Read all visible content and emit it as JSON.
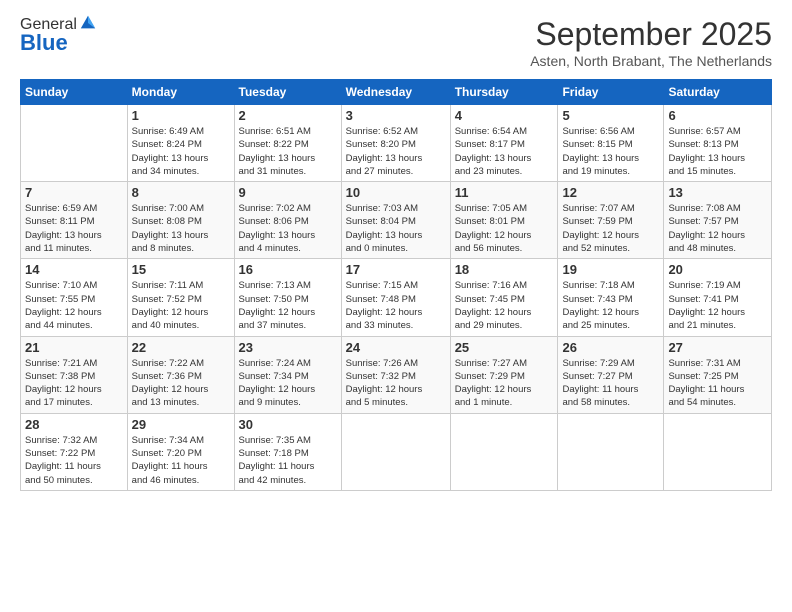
{
  "header": {
    "logo_line1": "General",
    "logo_line2": "Blue",
    "month_title": "September 2025",
    "subtitle": "Asten, North Brabant, The Netherlands"
  },
  "weekdays": [
    "Sunday",
    "Monday",
    "Tuesday",
    "Wednesday",
    "Thursday",
    "Friday",
    "Saturday"
  ],
  "weeks": [
    [
      {
        "day": "",
        "info": ""
      },
      {
        "day": "1",
        "info": "Sunrise: 6:49 AM\nSunset: 8:24 PM\nDaylight: 13 hours\nand 34 minutes."
      },
      {
        "day": "2",
        "info": "Sunrise: 6:51 AM\nSunset: 8:22 PM\nDaylight: 13 hours\nand 31 minutes."
      },
      {
        "day": "3",
        "info": "Sunrise: 6:52 AM\nSunset: 8:20 PM\nDaylight: 13 hours\nand 27 minutes."
      },
      {
        "day": "4",
        "info": "Sunrise: 6:54 AM\nSunset: 8:17 PM\nDaylight: 13 hours\nand 23 minutes."
      },
      {
        "day": "5",
        "info": "Sunrise: 6:56 AM\nSunset: 8:15 PM\nDaylight: 13 hours\nand 19 minutes."
      },
      {
        "day": "6",
        "info": "Sunrise: 6:57 AM\nSunset: 8:13 PM\nDaylight: 13 hours\nand 15 minutes."
      }
    ],
    [
      {
        "day": "7",
        "info": "Sunrise: 6:59 AM\nSunset: 8:11 PM\nDaylight: 13 hours\nand 11 minutes."
      },
      {
        "day": "8",
        "info": "Sunrise: 7:00 AM\nSunset: 8:08 PM\nDaylight: 13 hours\nand 8 minutes."
      },
      {
        "day": "9",
        "info": "Sunrise: 7:02 AM\nSunset: 8:06 PM\nDaylight: 13 hours\nand 4 minutes."
      },
      {
        "day": "10",
        "info": "Sunrise: 7:03 AM\nSunset: 8:04 PM\nDaylight: 13 hours\nand 0 minutes."
      },
      {
        "day": "11",
        "info": "Sunrise: 7:05 AM\nSunset: 8:01 PM\nDaylight: 12 hours\nand 56 minutes."
      },
      {
        "day": "12",
        "info": "Sunrise: 7:07 AM\nSunset: 7:59 PM\nDaylight: 12 hours\nand 52 minutes."
      },
      {
        "day": "13",
        "info": "Sunrise: 7:08 AM\nSunset: 7:57 PM\nDaylight: 12 hours\nand 48 minutes."
      }
    ],
    [
      {
        "day": "14",
        "info": "Sunrise: 7:10 AM\nSunset: 7:55 PM\nDaylight: 12 hours\nand 44 minutes."
      },
      {
        "day": "15",
        "info": "Sunrise: 7:11 AM\nSunset: 7:52 PM\nDaylight: 12 hours\nand 40 minutes."
      },
      {
        "day": "16",
        "info": "Sunrise: 7:13 AM\nSunset: 7:50 PM\nDaylight: 12 hours\nand 37 minutes."
      },
      {
        "day": "17",
        "info": "Sunrise: 7:15 AM\nSunset: 7:48 PM\nDaylight: 12 hours\nand 33 minutes."
      },
      {
        "day": "18",
        "info": "Sunrise: 7:16 AM\nSunset: 7:45 PM\nDaylight: 12 hours\nand 29 minutes."
      },
      {
        "day": "19",
        "info": "Sunrise: 7:18 AM\nSunset: 7:43 PM\nDaylight: 12 hours\nand 25 minutes."
      },
      {
        "day": "20",
        "info": "Sunrise: 7:19 AM\nSunset: 7:41 PM\nDaylight: 12 hours\nand 21 minutes."
      }
    ],
    [
      {
        "day": "21",
        "info": "Sunrise: 7:21 AM\nSunset: 7:38 PM\nDaylight: 12 hours\nand 17 minutes."
      },
      {
        "day": "22",
        "info": "Sunrise: 7:22 AM\nSunset: 7:36 PM\nDaylight: 12 hours\nand 13 minutes."
      },
      {
        "day": "23",
        "info": "Sunrise: 7:24 AM\nSunset: 7:34 PM\nDaylight: 12 hours\nand 9 minutes."
      },
      {
        "day": "24",
        "info": "Sunrise: 7:26 AM\nSunset: 7:32 PM\nDaylight: 12 hours\nand 5 minutes."
      },
      {
        "day": "25",
        "info": "Sunrise: 7:27 AM\nSunset: 7:29 PM\nDaylight: 12 hours\nand 1 minute."
      },
      {
        "day": "26",
        "info": "Sunrise: 7:29 AM\nSunset: 7:27 PM\nDaylight: 11 hours\nand 58 minutes."
      },
      {
        "day": "27",
        "info": "Sunrise: 7:31 AM\nSunset: 7:25 PM\nDaylight: 11 hours\nand 54 minutes."
      }
    ],
    [
      {
        "day": "28",
        "info": "Sunrise: 7:32 AM\nSunset: 7:22 PM\nDaylight: 11 hours\nand 50 minutes."
      },
      {
        "day": "29",
        "info": "Sunrise: 7:34 AM\nSunset: 7:20 PM\nDaylight: 11 hours\nand 46 minutes."
      },
      {
        "day": "30",
        "info": "Sunrise: 7:35 AM\nSunset: 7:18 PM\nDaylight: 11 hours\nand 42 minutes."
      },
      {
        "day": "",
        "info": ""
      },
      {
        "day": "",
        "info": ""
      },
      {
        "day": "",
        "info": ""
      },
      {
        "day": "",
        "info": ""
      }
    ]
  ]
}
